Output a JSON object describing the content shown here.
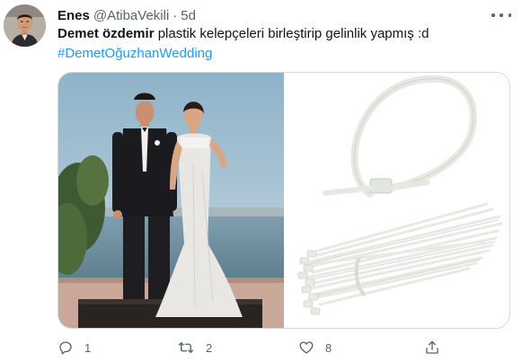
{
  "tweet": {
    "display_name": "Enes",
    "handle": "@AtibaVekili",
    "separator": "·",
    "timestamp": "5d",
    "text_bold": "Demet özdemir",
    "text_rest": " plastik kelepçeleri birleştirip gelinlik yapmış :d",
    "hashtag": "#DemetOğuzhanWedding"
  },
  "media": {
    "left_image": "wedding-photo",
    "right_image": "cable-ties-photo"
  },
  "actions": {
    "reply_count": "1",
    "retweet_count": "2",
    "like_count": "8"
  },
  "colors": {
    "text": "#0f1419",
    "muted": "#536471",
    "link": "#1d9bf0",
    "border": "#cfd9de"
  }
}
